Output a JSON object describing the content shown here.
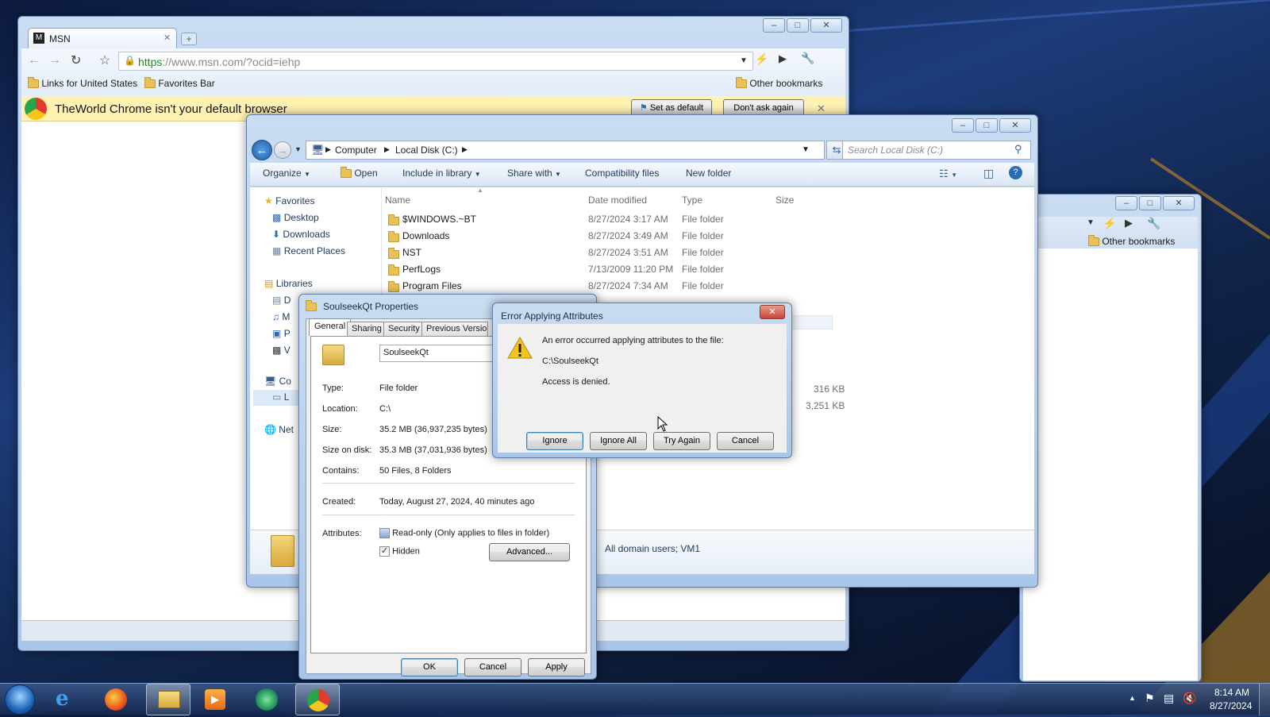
{
  "browser": {
    "tab_title": "MSN",
    "url_https": "https",
    "url_host": "://www.msn.com",
    "url_rest": "/?ocid=iehp",
    "bookmarks": [
      "Links for United States",
      "Favorites Bar"
    ],
    "other_bookmarks": "Other bookmarks",
    "infobar_text": "TheWorld Chrome isn't your default browser",
    "set_default": "Set as default",
    "dont_ask": "Don't ask again"
  },
  "explorer": {
    "breadcrumb": [
      "Computer",
      "Local Disk (C:)"
    ],
    "search_placeholder": "Search Local Disk (C:)",
    "toolbar": {
      "organize": "Organize",
      "open": "Open",
      "include": "Include in library",
      "share": "Share with",
      "compat": "Compatibility files",
      "new_folder": "New folder"
    },
    "nav": {
      "favorites": "Favorites",
      "desktop": "Desktop",
      "downloads": "Downloads",
      "recent": "Recent Places",
      "libraries": "Libraries",
      "lib_d": "D",
      "lib_m": "M",
      "lib_p": "P",
      "lib_v": "V",
      "computer": "Co",
      "local": "L",
      "network": "Net"
    },
    "columns": [
      "Name",
      "Date modified",
      "Type",
      "Size"
    ],
    "rows": [
      {
        "name": "$WINDOWS.~BT",
        "date": "8/27/2024 3:17 AM",
        "type": "File folder"
      },
      {
        "name": "Downloads",
        "date": "8/27/2024 3:49 AM",
        "type": "File folder"
      },
      {
        "name": "NST",
        "date": "8/27/2024 3:51 AM",
        "type": "File folder"
      },
      {
        "name": "PerfLogs",
        "date": "7/13/2009 11:20 PM",
        "type": "File folder"
      },
      {
        "name": "Program Files",
        "date": "8/27/2024 7:34 AM",
        "type": "File folder"
      }
    ],
    "sizes": [
      "316 KB",
      "3,251 KB"
    ],
    "status_text": "All domain users; VM1"
  },
  "second_browser": {
    "other_bookmarks": "Other bookmarks"
  },
  "properties": {
    "title": "SoulseekQt Properties",
    "tabs": [
      "General",
      "Sharing",
      "Security",
      "Previous Versions"
    ],
    "name_value": "SoulseekQt",
    "fields": [
      {
        "label": "Type:",
        "value": "File folder"
      },
      {
        "label": "Location:",
        "value": "C:\\"
      },
      {
        "label": "Size:",
        "value": "35.2 MB (36,937,235 bytes)"
      },
      {
        "label": "Size on disk:",
        "value": "35.3 MB (37,031,936 bytes)"
      },
      {
        "label": "Contains:",
        "value": "50 Files, 8 Folders"
      }
    ],
    "created_label": "Created:",
    "created_value": "Today, August 27, 2024, 40 minutes ago",
    "attributes_label": "Attributes:",
    "readonly_label": "Read-only (Only applies to files in folder)",
    "hidden_label": "Hidden",
    "hidden_check": "✓",
    "advanced": "Advanced...",
    "ok": "OK",
    "cancel": "Cancel",
    "apply": "Apply"
  },
  "error": {
    "title": "Error Applying Attributes",
    "message": "An error occurred applying attributes to the file:",
    "path": "C:\\SoulseekQt",
    "detail": "Access is denied.",
    "ignore": "Ignore",
    "ignore_all": "Ignore All",
    "try_again": "Try Again",
    "cancel": "Cancel"
  },
  "taskbar": {
    "time": "8:14 AM",
    "date": "8/27/2024"
  },
  "colors": {
    "infobar": "#fff2b3",
    "link_green": "#1f8a28",
    "taskbar": "#1c3356"
  }
}
